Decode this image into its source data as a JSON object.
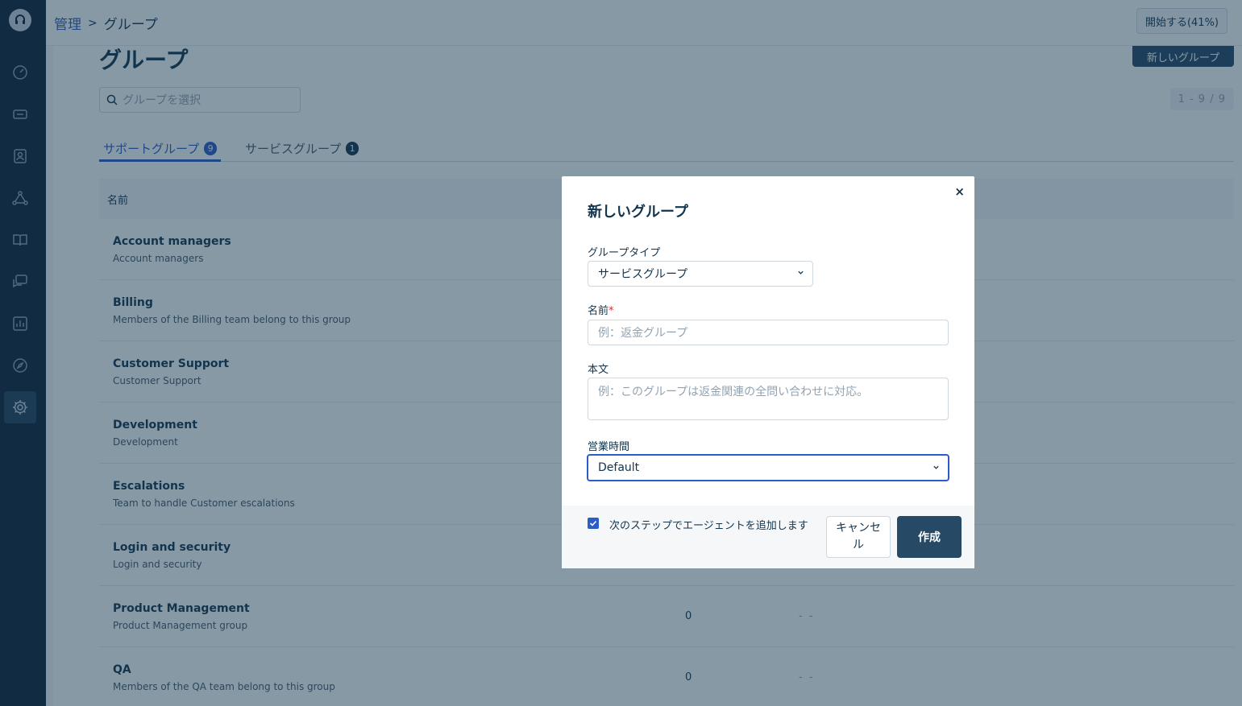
{
  "breadcrumb": {
    "parent": "管理",
    "separator": ">",
    "current": "グループ"
  },
  "header": {
    "start_button": "開始する(41%)"
  },
  "page": {
    "title": "グループ",
    "new_group_button": "新しいグループ",
    "search_placeholder": "グループを選択",
    "pagination": "1 - 9 / 9"
  },
  "tabs": [
    {
      "label": "サポートグループ",
      "count": "9"
    },
    {
      "label": "サービスグループ",
      "count": "1"
    }
  ],
  "table": {
    "header_name": "名前",
    "rows": [
      {
        "name": "Account managers",
        "desc": "Account managers",
        "count": "",
        "dash": ""
      },
      {
        "name": "Billing",
        "desc": "Members of the Billing team belong to this group",
        "count": "",
        "dash": ""
      },
      {
        "name": "Customer Support",
        "desc": "Customer Support",
        "count": "",
        "dash": ""
      },
      {
        "name": "Development",
        "desc": "Development",
        "count": "",
        "dash": ""
      },
      {
        "name": "Escalations",
        "desc": "Team to handle Customer escalations",
        "count": "",
        "dash": ""
      },
      {
        "name": "Login and security",
        "desc": "Login and security",
        "count": "",
        "dash": ""
      },
      {
        "name": "Product Management",
        "desc": "Product Management group",
        "count": "0",
        "dash": "- -"
      },
      {
        "name": "QA",
        "desc": "Members of the QA team belong to this group",
        "count": "0",
        "dash": "- -"
      }
    ]
  },
  "modal": {
    "close": "×",
    "title": "新しいグループ",
    "group_type_label": "グループタイプ",
    "group_type_value": "サービスグループ",
    "name_label": "名前",
    "name_required": "*",
    "name_placeholder": "例：返金グループ",
    "body_label": "本文",
    "body_placeholder": "例：このグループは返金関連の全問い合わせに対応。",
    "hours_label": "営業時間",
    "hours_value": "Default",
    "checkbox_label": "次のステップでエージェントを追加します",
    "checkbox_checked": true,
    "cancel_button": "キャンセル",
    "create_button": "作成"
  },
  "colors": {
    "sidebar": "#0e2337",
    "accent": "#2c5cc5",
    "primary_button": "#264966",
    "required": "#d72d30"
  },
  "sidebar": {
    "icons": [
      "headset-logo-icon",
      "dashboard-icon",
      "ticket-icon",
      "contacts-icon",
      "social-icon",
      "book-icon",
      "chat-icon",
      "analytics-icon",
      "compass-icon",
      "gear-icon"
    ]
  }
}
